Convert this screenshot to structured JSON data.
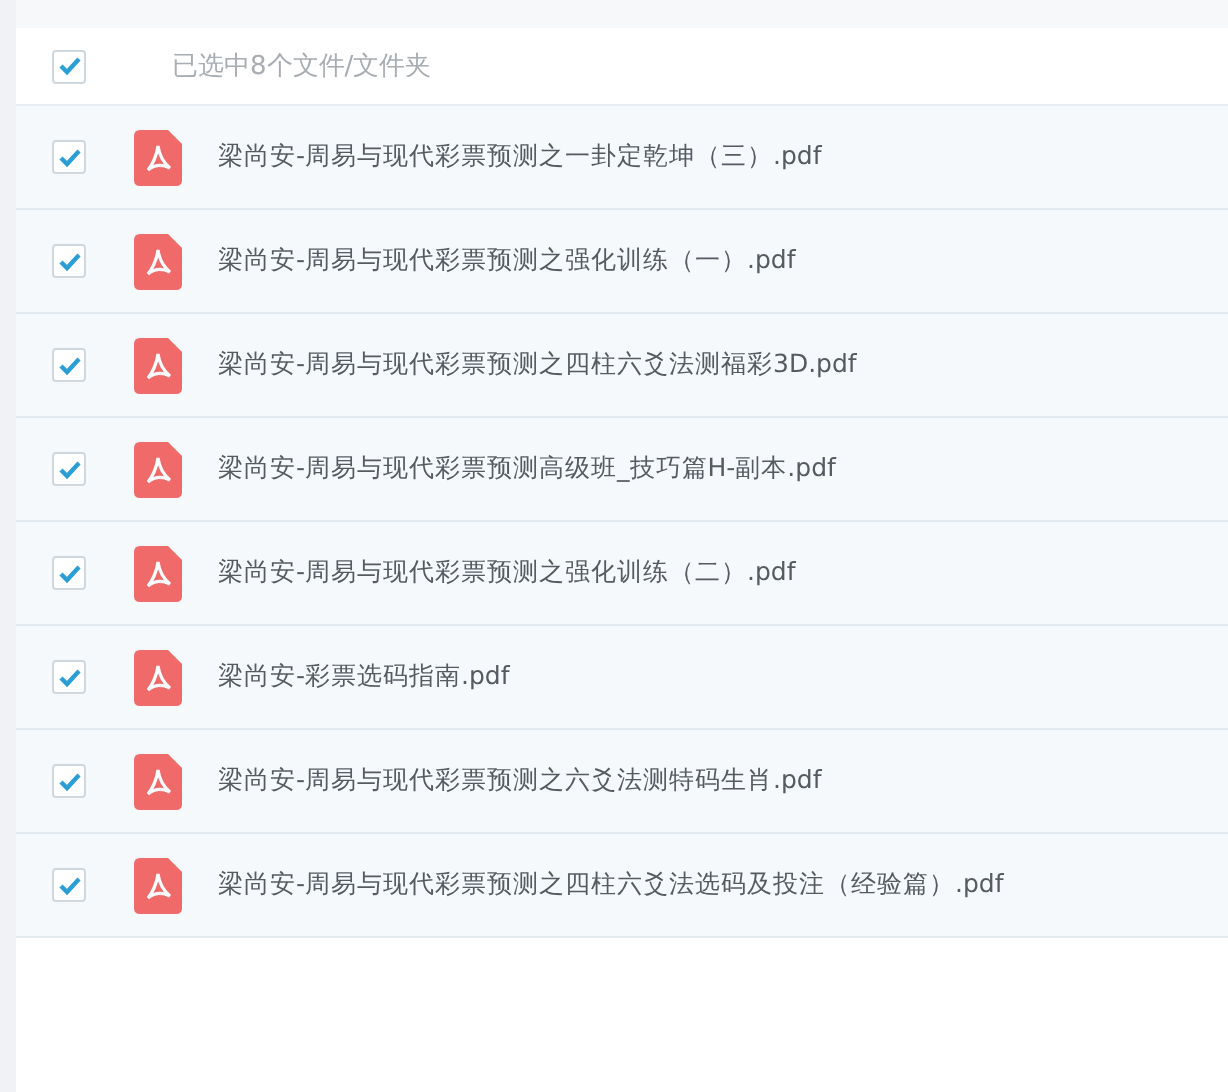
{
  "select_all": {
    "checked": true,
    "label": "已选中8个文件/文件夹"
  },
  "files": [
    {
      "name": "梁尚安-周易与现代彩票预测之一卦定乾坤（三）.pdf",
      "checked": true
    },
    {
      "name": "梁尚安-周易与现代彩票预测之强化训练（一）.pdf",
      "checked": true
    },
    {
      "name": "梁尚安-周易与现代彩票预测之四柱六爻法测福彩3D.pdf",
      "checked": true
    },
    {
      "name": "梁尚安-周易与现代彩票预测高级班_技巧篇H-副本.pdf",
      "checked": true
    },
    {
      "name": "梁尚安-周易与现代彩票预测之强化训练（二）.pdf",
      "checked": true
    },
    {
      "name": "梁尚安-彩票选码指南.pdf",
      "checked": true
    },
    {
      "name": "梁尚安-周易与现代彩票预测之六爻法测特码生肖.pdf",
      "checked": true
    },
    {
      "name": "梁尚安-周易与现代彩票预测之四柱六爻法选码及投注（经验篇）.pdf",
      "checked": true
    }
  ]
}
